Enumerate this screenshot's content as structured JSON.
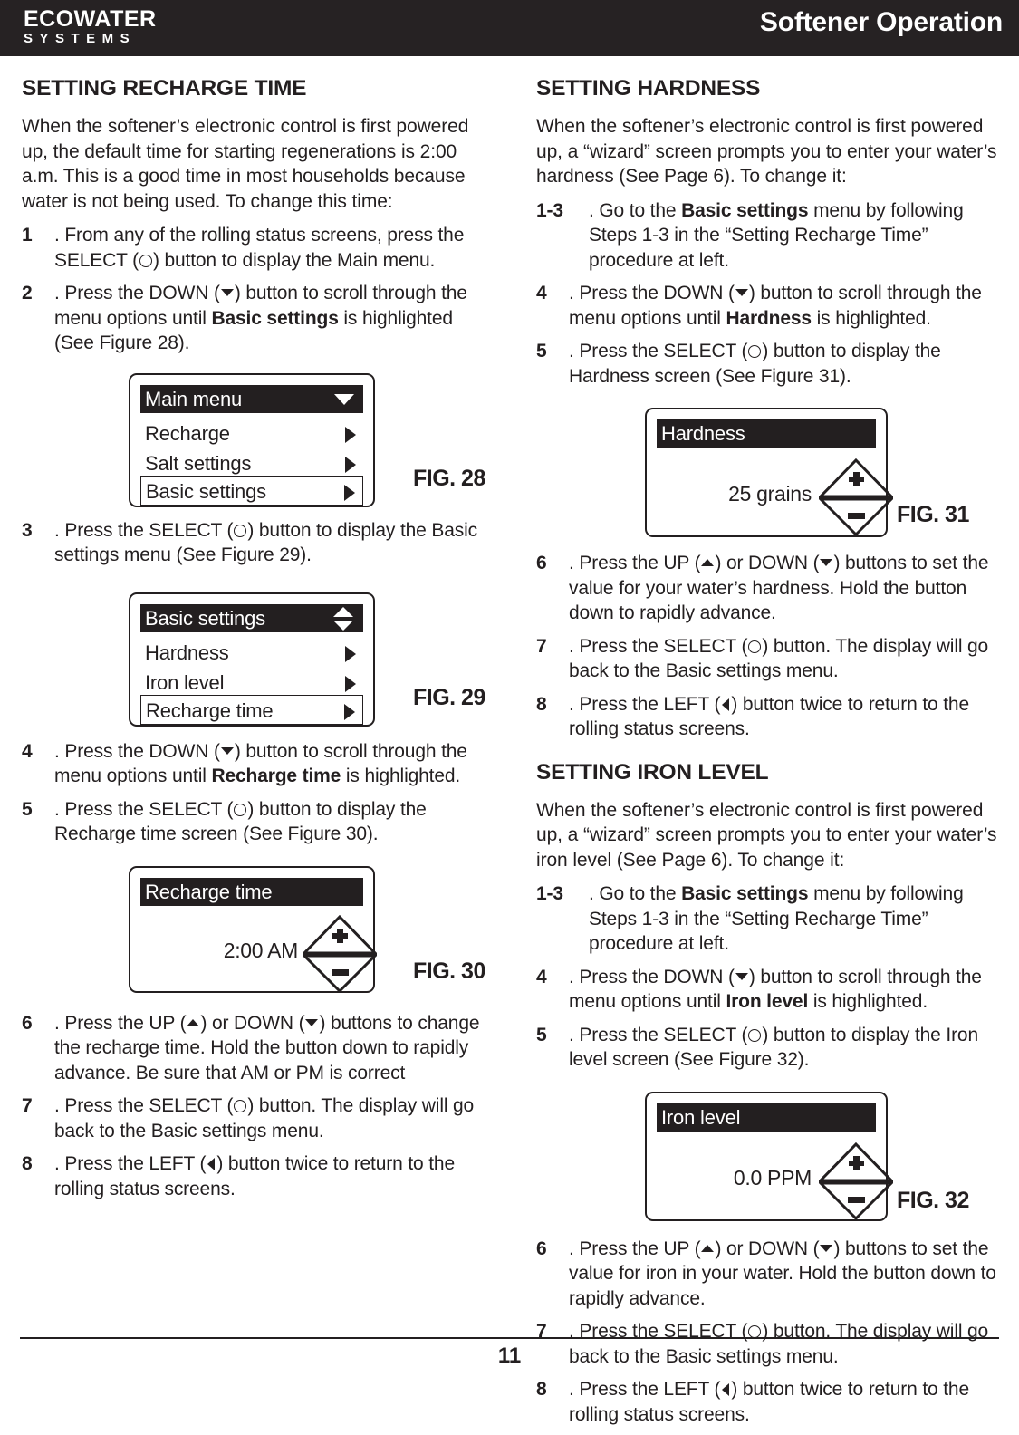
{
  "header": {
    "logo_main": "ECOWATER",
    "logo_sub": "SYSTEMS",
    "title": "Softener Operation"
  },
  "footer": {
    "page_number": "11"
  },
  "left_column": {
    "section_title": "SETTING RECHARGE TIME",
    "intro": "When the softener’s electronic control is first powered up, the default time for starting regenerations is 2:00 a.m.  This is a good time in most households because water is not being used.  To change this time:",
    "steps": {
      "s1_num": "1",
      "s1_a": ". From any of the rolling status screens, press the SELECT (",
      "s1_b": ") button to display the Main menu.",
      "s2_num": "2",
      "s2_a": ". Press the DOWN (",
      "s2_b": ") button to scroll through the menu options until ",
      "s2_bold": "Basic settings",
      "s2_c": " is highlighted (See Figure 28).",
      "s3_num": "3",
      "s3_a": ". Press the SELECT (",
      "s3_b": ") button to display the Basic settings menu (See Figure 29).",
      "s4_num": "4",
      "s4_a": ". Press the DOWN (",
      "s4_b": ") button to scroll through the menu options until ",
      "s4_bold": "Recharge time",
      "s4_c": " is highlighted.",
      "s5_num": "5",
      "s5_a": ". Press the SELECT (",
      "s5_b": ") button to display the Recharge time screen (See Figure 30).",
      "s6_num": "6",
      "s6_a": ". Press the UP (",
      "s6_b": ") or DOWN (",
      "s6_c": ") buttons to change the recharge time.  Hold the button down to rapidly advance.  Be sure that AM or PM is correct",
      "s7_num": "7",
      "s7_a": ". Press the SELECT (",
      "s7_b": ") button.  The display will go back to the Basic settings menu.",
      "s8_num": "8",
      "s8_a": ". Press the LEFT (",
      "s8_b": ") button twice to return to the rolling status screens."
    },
    "figures": {
      "fig28": {
        "label": "FIG. 28",
        "title": "Main menu",
        "scroll_icon": "chevron-down-icon",
        "rows": [
          {
            "label": "Recharge",
            "selected": false
          },
          {
            "label": "Salt settings",
            "selected": false
          },
          {
            "label": "Basic settings",
            "selected": true
          }
        ]
      },
      "fig29": {
        "label": "FIG. 29",
        "title": "Basic settings",
        "scroll_icon": "chevron-up-down-icon",
        "rows": [
          {
            "label": "Hardness",
            "selected": false
          },
          {
            "label": "Iron level",
            "selected": false
          },
          {
            "label": "Recharge time",
            "selected": true
          }
        ]
      },
      "fig30": {
        "label": "FIG. 30",
        "title": "Recharge time",
        "value": "2:00 AM",
        "adjust_icon": "plus-minus-icon"
      }
    }
  },
  "right_column": {
    "section1_title": "SETTING HARDNESS",
    "section1_intro": "When the softener’s electronic control is first powered up, a “wizard” screen prompts you to enter your water’s hardness (See Page 6).  To change it:",
    "section1_steps": {
      "s13_num": "1-3",
      "s13_a": ". Go to the ",
      "s13_bold": "Basic settings",
      "s13_b": " menu by following Steps 1-3 in the “Setting Recharge Time” procedure at left.",
      "s4_num": "4",
      "s4_a": ". Press the DOWN (",
      "s4_b": ") button to scroll through the menu options until ",
      "s4_bold": "Hardness",
      "s4_c": " is highlighted.",
      "s5_num": "5",
      "s5_a": ". Press the SELECT (",
      "s5_b": ") button to display the Hardness screen (See Figure 31).",
      "s6_num": "6",
      "s6_a": ". Press the UP (",
      "s6_b": ") or DOWN (",
      "s6_c": ") buttons to set the value for your water’s hardness.  Hold the button down to rapidly advance.",
      "s7_num": "7",
      "s7_a": ". Press the SELECT (",
      "s7_b": ") button.  The display will go back to the Basic settings menu.",
      "s8_num": "8",
      "s8_a": ". Press the LEFT (",
      "s8_b": ") button twice to return to the rolling status screens."
    },
    "fig31": {
      "label": "FIG. 31",
      "title": "Hardness",
      "value": "25 grains",
      "adjust_icon": "plus-minus-icon"
    },
    "section2_title": "SETTING IRON LEVEL",
    "section2_intro": "When the softener’s electronic control is first powered up, a “wizard” screen prompts you to enter your water’s iron level (See Page 6).  To change it:",
    "section2_steps": {
      "s13_num": "1-3",
      "s13_a": ". Go to the ",
      "s13_bold": "Basic settings",
      "s13_b": " menu by following Steps 1-3 in the “Setting Recharge Time” procedure at left.",
      "s4_num": "4",
      "s4_a": ". Press the DOWN (",
      "s4_b": ") button to scroll through the menu options until ",
      "s4_bold": "Iron level",
      "s4_c": " is highlighted.",
      "s5_num": "5",
      "s5_a": ". Press the SELECT (",
      "s5_b": ") button to display the Iron level screen (See Figure 32).",
      "s6_num": "6",
      "s6_a": ". Press the UP (",
      "s6_b": ") or DOWN (",
      "s6_c": ") buttons to set the value for iron in your water.  Hold the button down to rapidly advance.",
      "s7_num": "7",
      "s7_a": ". Press the SELECT (",
      "s7_b": ") button.  The display will go back to the Basic settings menu.",
      "s8_num": "8",
      "s8_a": ". Press the LEFT (",
      "s8_b": ") button twice to return to the rolling status screens."
    },
    "fig32": {
      "label": "FIG. 32",
      "title": "Iron level",
      "value": "0.0 PPM",
      "adjust_icon": "plus-minus-icon"
    }
  }
}
